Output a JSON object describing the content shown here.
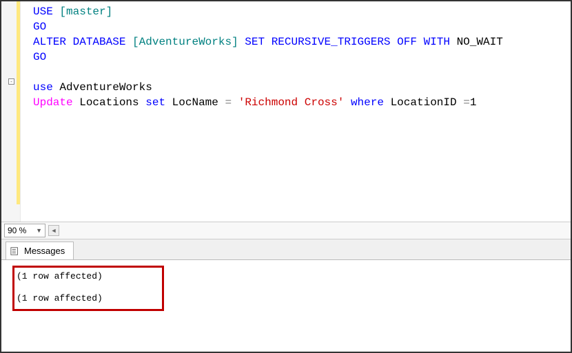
{
  "code": {
    "l1": {
      "use": "USE",
      "master": "[master]"
    },
    "l2": {
      "go": "GO"
    },
    "l3": {
      "alter": "ALTER",
      "database": "DATABASE",
      "db": "[AdventureWorks]",
      "set": "SET",
      "opt": "RECURSIVE_TRIGGERS",
      "off": "OFF",
      "with": "WITH",
      "nowait": "NO_WAIT"
    },
    "l4": {
      "go": "GO"
    },
    "l6": {
      "use": "use",
      "db": "AdventureWorks"
    },
    "l7": {
      "update": "Update",
      "tbl": "Locations",
      "set": "set",
      "col": "LocName",
      "eq": "=",
      "val": "'Richmond Cross'",
      "where": "where",
      "cond1": "LocationID",
      "cond2": "=",
      "cond3": "1"
    }
  },
  "zoom": {
    "value": "90 %"
  },
  "fold": {
    "symbol": "-"
  },
  "tabs": {
    "messages": "Messages"
  },
  "messages": {
    "line1": "(1 row affected)",
    "line2": "(1 row affected)"
  }
}
